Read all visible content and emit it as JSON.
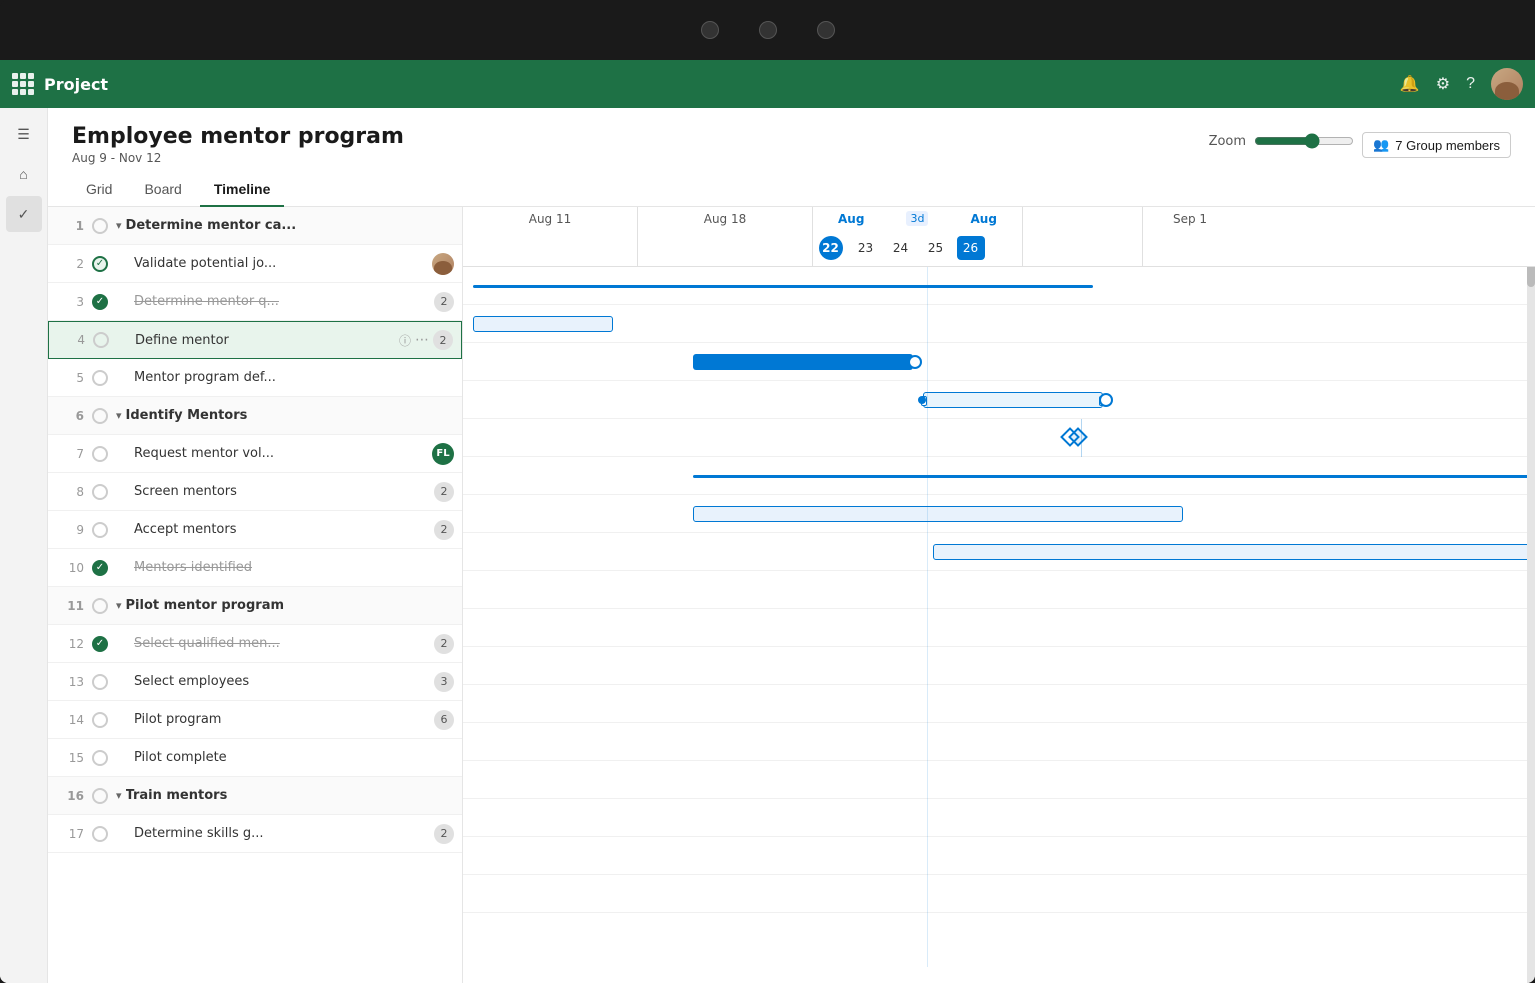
{
  "os_bar": {
    "dots": 3
  },
  "header": {
    "title": "Project",
    "grid_icon": "grid-icon",
    "bell_icon": "🔔",
    "settings_icon": "⚙",
    "help_icon": "?",
    "avatar_initials": "User"
  },
  "left_rail": {
    "hamburger": "☰",
    "home": "⌂",
    "check": "✓"
  },
  "project": {
    "title": "Employee mentor program",
    "dates": "Aug 9 - Nov 12"
  },
  "nav_tabs": {
    "tabs": [
      {
        "id": "grid",
        "label": "Grid",
        "active": false
      },
      {
        "id": "board",
        "label": "Board",
        "active": false
      },
      {
        "id": "timeline",
        "label": "Timeline",
        "active": true
      }
    ]
  },
  "zoom": {
    "label": "Zoom"
  },
  "group_members": {
    "count": 7,
    "label": "7 Group members"
  },
  "gantt_header": {
    "weeks": [
      {
        "label": "Aug 11",
        "highlight": false,
        "days": []
      },
      {
        "label": "Aug 18",
        "highlight": false,
        "days": []
      },
      {
        "label": "Aug",
        "highlight": true,
        "subLabel": "3d",
        "days": [
          {
            "num": "22",
            "highlight": true
          },
          {
            "num": "23",
            "highlight": false
          },
          {
            "num": "24",
            "highlight": false
          },
          {
            "num": "25",
            "highlight": false
          },
          {
            "num": "26",
            "highlight": true
          }
        ]
      },
      {
        "label": "Aug",
        "highlight": false,
        "days": []
      },
      {
        "label": "Sep 1",
        "highlight": false,
        "days": []
      }
    ]
  },
  "tasks": [
    {
      "id": 1,
      "num": "1",
      "name": "Determine mentor ca...",
      "status": "circle",
      "badge": null,
      "avatar": null,
      "group": true,
      "chevron": "▾",
      "indent": 0,
      "strikethrough": false
    },
    {
      "id": 2,
      "num": "2",
      "name": "Validate potential jo...",
      "status": "check-light",
      "badge": null,
      "avatar": "person",
      "group": false,
      "indent": 1,
      "strikethrough": false
    },
    {
      "id": 3,
      "num": "3",
      "name": "Determine mentor q...",
      "status": "check-green",
      "badge": "2",
      "avatar": null,
      "group": false,
      "indent": 1,
      "strikethrough": true
    },
    {
      "id": 4,
      "num": "4",
      "name": "Define mentor",
      "status": "circle",
      "badge": "2",
      "avatar": null,
      "group": false,
      "indent": 1,
      "strikethrough": false,
      "selected": true,
      "info": true,
      "more": true
    },
    {
      "id": 5,
      "num": "5",
      "name": "Mentor program def...",
      "status": "circle",
      "badge": null,
      "avatar": null,
      "group": false,
      "indent": 1,
      "strikethrough": false
    },
    {
      "id": 6,
      "num": "6",
      "name": "Identify Mentors",
      "status": "circle",
      "badge": null,
      "avatar": null,
      "group": true,
      "chevron": "▾",
      "indent": 0,
      "strikethrough": false
    },
    {
      "id": 7,
      "num": "7",
      "name": "Request mentor vol...",
      "status": "circle",
      "badge": null,
      "avatar": "fl",
      "group": false,
      "indent": 1,
      "strikethrough": false
    },
    {
      "id": 8,
      "num": "8",
      "name": "Screen mentors",
      "status": "circle",
      "badge": "2",
      "avatar": null,
      "group": false,
      "indent": 1,
      "strikethrough": false
    },
    {
      "id": 9,
      "num": "9",
      "name": "Accept mentors",
      "status": "circle",
      "badge": "2",
      "avatar": null,
      "group": false,
      "indent": 1,
      "strikethrough": false
    },
    {
      "id": 10,
      "num": "10",
      "name": "Mentors identified",
      "status": "check-green",
      "badge": null,
      "avatar": null,
      "group": false,
      "indent": 1,
      "strikethrough": true
    },
    {
      "id": 11,
      "num": "11",
      "name": "Pilot mentor program",
      "status": "circle",
      "badge": null,
      "avatar": null,
      "group": true,
      "chevron": "▾",
      "indent": 0,
      "strikethrough": false
    },
    {
      "id": 12,
      "num": "12",
      "name": "Select qualified men...",
      "status": "check-green",
      "badge": "2",
      "avatar": null,
      "group": false,
      "indent": 1,
      "strikethrough": true
    },
    {
      "id": 13,
      "num": "13",
      "name": "Select employees",
      "status": "circle",
      "badge": "3",
      "avatar": null,
      "group": false,
      "indent": 1,
      "strikethrough": false
    },
    {
      "id": 14,
      "num": "14",
      "name": "Pilot program",
      "status": "circle",
      "badge": "6",
      "avatar": null,
      "group": false,
      "indent": 1,
      "strikethrough": false
    },
    {
      "id": 15,
      "num": "15",
      "name": "Pilot complete",
      "status": "circle",
      "badge": null,
      "avatar": null,
      "group": false,
      "indent": 1,
      "strikethrough": false
    },
    {
      "id": 16,
      "num": "16",
      "name": "Train mentors",
      "status": "circle",
      "badge": null,
      "avatar": null,
      "group": true,
      "chevron": "▾",
      "indent": 0,
      "strikethrough": false
    },
    {
      "id": 17,
      "num": "17",
      "name": "Determine skills g...",
      "status": "circle",
      "badge": "2",
      "avatar": null,
      "group": false,
      "indent": 1,
      "strikethrough": false
    }
  ]
}
